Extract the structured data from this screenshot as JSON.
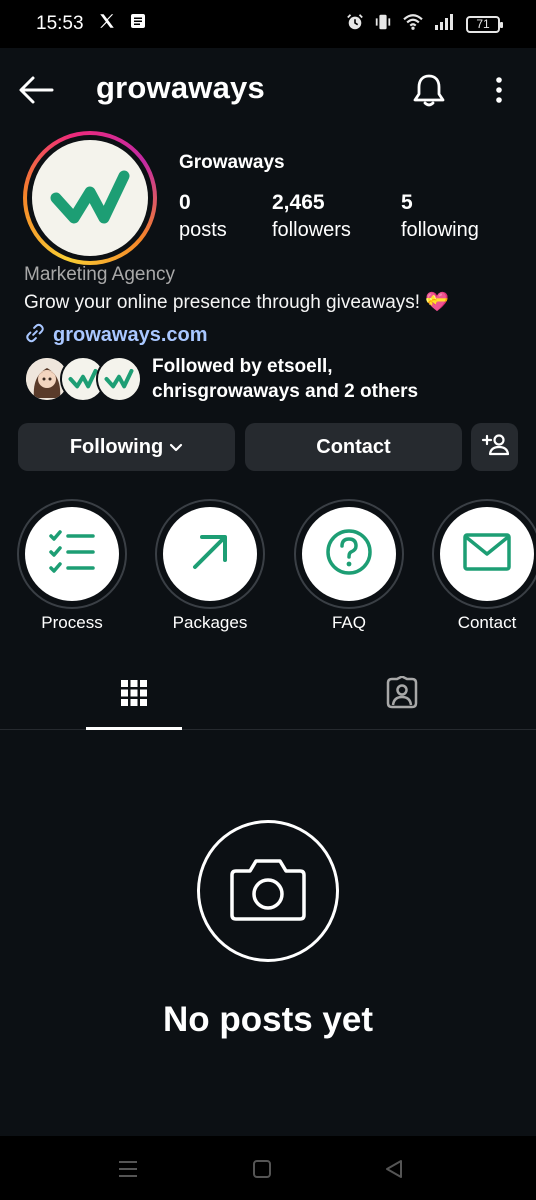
{
  "status_bar": {
    "time": "15:53",
    "battery": "71"
  },
  "header": {
    "username": "growaways"
  },
  "profile": {
    "display_name": "Growaways",
    "stats": [
      {
        "value": "0",
        "label": "posts"
      },
      {
        "value": "2,465",
        "label": "followers"
      },
      {
        "value": "5",
        "label": "following"
      }
    ],
    "category": "Marketing Agency",
    "bio": "Grow your online presence through giveaways! 💝",
    "link": "growaways.com",
    "followed_by_line1": "Followed by etsoell,",
    "followed_by_line2": "chrisgrowaways and 2 others"
  },
  "actions": {
    "following_label": "Following",
    "contact_label": "Contact"
  },
  "highlights": [
    {
      "label": "Process",
      "icon": "checklist-icon"
    },
    {
      "label": "Packages",
      "icon": "arrow-up-right-icon"
    },
    {
      "label": "FAQ",
      "icon": "question-icon"
    },
    {
      "label": "Contact",
      "icon": "mail-icon"
    }
  ],
  "tabs": [
    {
      "name": "grid",
      "icon": "grid-icon",
      "active": true
    },
    {
      "name": "tagged",
      "icon": "tagged-icon",
      "active": false
    }
  ],
  "empty_state": {
    "text": "No posts yet"
  },
  "colors": {
    "background": "#0c1014",
    "accent_green": "#1d9e74",
    "link": "#a9c7ff",
    "button": "#262a2f"
  }
}
